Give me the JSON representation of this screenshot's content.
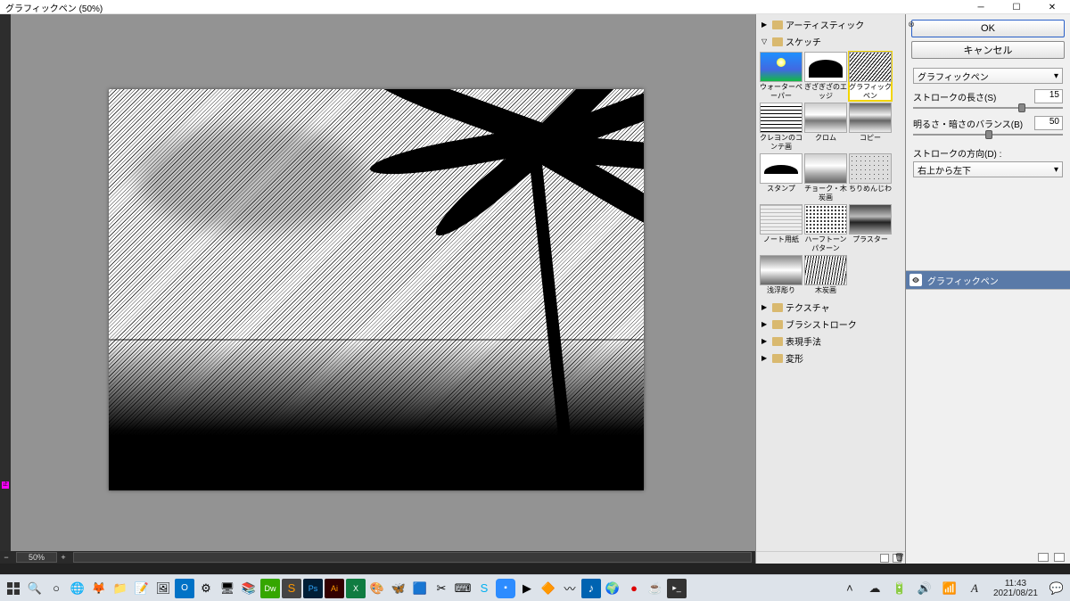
{
  "title": "グラフィックペン (50%)",
  "zoom": "50%",
  "filterCategories": {
    "artistic": "アーティスティック",
    "sketch": "スケッチ",
    "texture": "テクスチャ",
    "brush": "ブラシストローク",
    "stylize": "表現手法",
    "distort": "変形"
  },
  "thumbs": {
    "water": "ウォーターペーパー",
    "edge": "ぎざぎざのエッジ",
    "gpen": "グラフィックペン",
    "cray": "クレヨンのコンテ画",
    "chrome": "クロム",
    "copy": "コピー",
    "stamp": "スタンプ",
    "chalk": "チョーク・木炭画",
    "retic": "ちりめんじわ",
    "note": "ノート用紙",
    "half": "ハーフトーンパターン",
    "plaster": "プラスター",
    "relief": "浅浮彫り",
    "charcoal": "木炭画"
  },
  "buttons": {
    "ok": "OK",
    "cancel": "キャンセル"
  },
  "params": {
    "filterName": "グラフィックペン",
    "strokeLenLabel": "ストロークの長さ(S)",
    "strokeLenVal": "15",
    "balanceLabel": "明るさ・暗さのバランス(B)",
    "balanceVal": "50",
    "dirLabel": "ストロークの方向(D) :",
    "dirVal": "右上から左下"
  },
  "layer": {
    "name": "グラフィックペン"
  },
  "taskbar": {
    "time": "11:43",
    "date": "2021/08/21"
  },
  "icons": {
    "chevUp": "^",
    "wifi": "wifi",
    "sound": "snd",
    "ime": "A"
  }
}
